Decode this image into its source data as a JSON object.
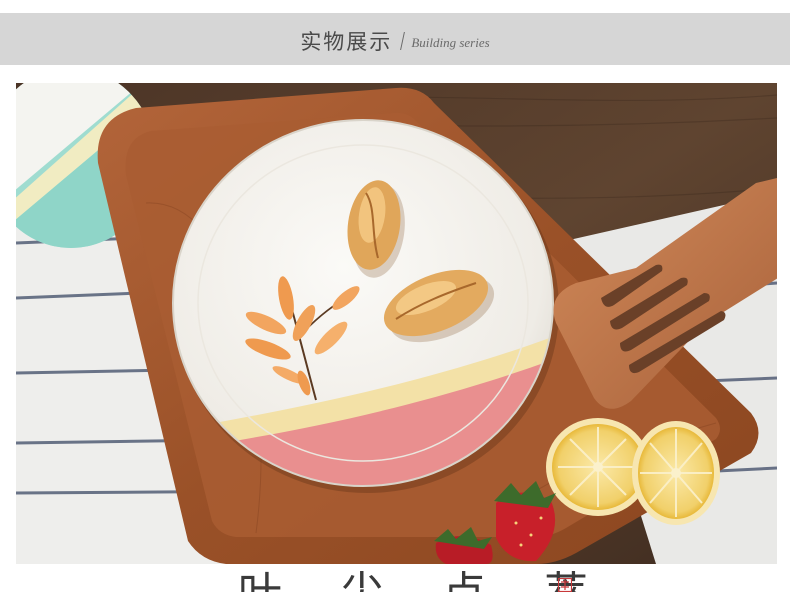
{
  "header": {
    "title": "实物展示",
    "subtitle": "Building series"
  },
  "footer": {
    "chars": "叶尖点萃"
  },
  "photo": {
    "scene": "plate-on-wooden-tray",
    "colors": {
      "table_wood": "#5a3f2a",
      "tray_wood": "#a35a2c",
      "plate_white": "#f5f3ef",
      "plate_pink": "#e98f8f",
      "plate_yellow_band": "#f3e1a7",
      "leaf_orange": "#ef9a4f",
      "lemon": "#f3d36b",
      "strawberry": "#c8202a"
    }
  }
}
